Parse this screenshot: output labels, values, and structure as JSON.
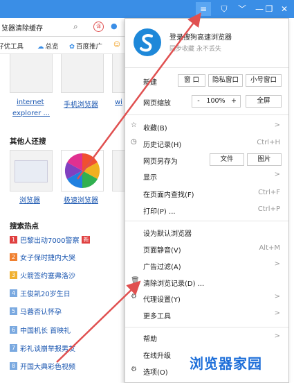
{
  "colors": {
    "titlebar": "#3a8ee6",
    "link": "#1a56b0",
    "arrow": "#e05050",
    "watermark": "#1e6fd9"
  },
  "addressbar": {
    "text": "览器清除缓存",
    "search_icon": "search-icon",
    "mic_icon": "microphone-icon"
  },
  "bookmarks": [
    {
      "icon": "star-icon",
      "label": "好优工具"
    },
    {
      "icon": "cloud-icon",
      "label": "总览"
    },
    {
      "icon": "paw-icon",
      "label": "百度推广"
    }
  ],
  "content": {
    "links_top": [
      "internet",
      "explorer ...",
      "手机浏览器",
      "wi"
    ],
    "others_title": "其他人还搜",
    "others": [
      "浏览器",
      "极速浏览器"
    ],
    "hot_title": "搜索热点",
    "hot": [
      {
        "num": "1",
        "text": "巴黎出动7000警察",
        "badge": "新",
        "color": "#e04040"
      },
      {
        "num": "2",
        "text": "女子保时捷内大哭",
        "badge": "",
        "color": "#f08030"
      },
      {
        "num": "3",
        "text": "火箭签约塞弗洛沙",
        "badge": "",
        "color": "#f0b030"
      },
      {
        "num": "4",
        "text": "王俊凯20岁生日",
        "badge": "",
        "color": "#7aa9e0"
      },
      {
        "num": "5",
        "text": "马蓉否认怀孕",
        "badge": "",
        "color": "#7aa9e0"
      },
      {
        "num": "6",
        "text": "中国机长 首映礼",
        "badge": "",
        "color": "#7aa9e0"
      },
      {
        "num": "7",
        "text": "彩礼谈崩举报男友",
        "badge": "",
        "color": "#7aa9e0"
      },
      {
        "num": "8",
        "text": "开国大典彩色视频",
        "badge": "",
        "color": "#7aa9e0"
      }
    ]
  },
  "menu": {
    "login_title": "登录搜狗高速浏览器",
    "login_sub": "同步收藏 永不丢失",
    "new_label": "新建",
    "new_buttons": [
      "窗 口",
      "隐私窗口",
      "小号窗口"
    ],
    "zoom_label": "网页缩放",
    "zoom_minus": "-",
    "zoom_value": "100%",
    "zoom_plus": "+",
    "fullscreen": "全屏",
    "items1": [
      {
        "icon": "star-icon",
        "label": "收藏(B)",
        "shortcut": "",
        "arrow": ">"
      },
      {
        "icon": "clock-icon",
        "label": "历史记录(H)",
        "shortcut": "Ctrl+H",
        "arrow": ""
      }
    ],
    "saveas_label": "网页另存为",
    "saveas_buttons": [
      "文件",
      "图片"
    ],
    "items2": [
      {
        "icon": "",
        "label": "显示",
        "shortcut": "",
        "arrow": ">"
      },
      {
        "icon": "",
        "label": "在页面内查找(F)",
        "shortcut": "Ctrl+F",
        "arrow": ""
      },
      {
        "icon": "",
        "label": "打印(P) ...",
        "shortcut": "Ctrl+P",
        "arrow": ""
      }
    ],
    "items3": [
      {
        "icon": "",
        "label": "设为默认浏览器",
        "shortcut": "",
        "arrow": ""
      },
      {
        "icon": "",
        "label": "页面静音(V)",
        "shortcut": "Alt+M",
        "arrow": ""
      },
      {
        "icon": "",
        "label": "广告过滤(A)",
        "shortcut": "",
        "arrow": ">"
      },
      {
        "icon": "trash-icon",
        "label": "清除浏览记录(D) ...",
        "shortcut": "",
        "arrow": ""
      },
      {
        "icon": "gear-icon",
        "label": "代理设置(Y)",
        "shortcut": "",
        "arrow": ">"
      },
      {
        "icon": "",
        "label": "更多工具",
        "shortcut": "",
        "arrow": ">"
      }
    ],
    "items4": [
      {
        "icon": "",
        "label": "帮助",
        "shortcut": "",
        "arrow": ">"
      },
      {
        "icon": "",
        "label": "在线升级",
        "shortcut": "",
        "arrow": ""
      },
      {
        "icon": "gear-icon",
        "label": "选项(O)",
        "shortcut": "",
        "arrow": ""
      }
    ]
  },
  "watermark": "浏览器家园"
}
